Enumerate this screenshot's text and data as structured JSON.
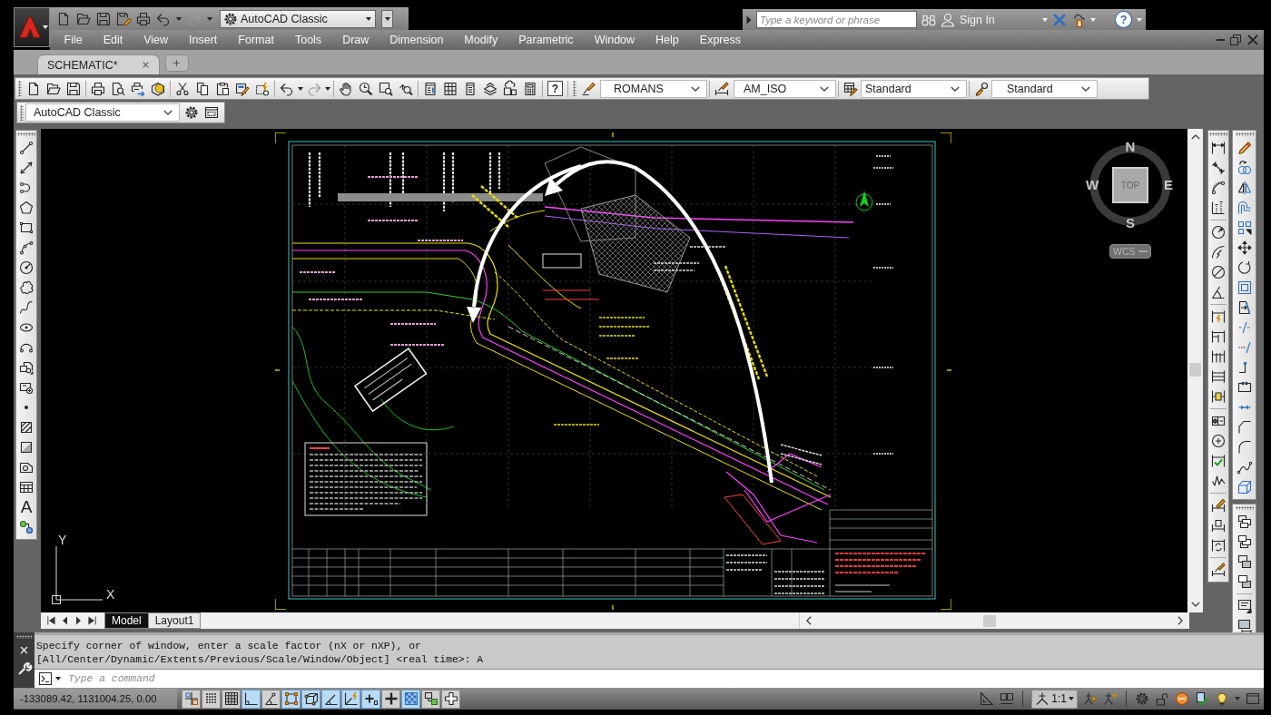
{
  "quick_access_toolbar": {
    "workspace": "AutoCAD Classic"
  },
  "infocenter": {
    "search": {
      "placeholder": "Type a keyword or phrase"
    },
    "sign_in": "Sign In",
    "help_glyph": "?"
  },
  "menu_bar": {
    "items": [
      "File",
      "Edit",
      "View",
      "Insert",
      "Format",
      "Tools",
      "Draw",
      "Dimension",
      "Modify",
      "Parametric",
      "Window",
      "Help",
      "Express"
    ]
  },
  "document_tabs": [
    {
      "label": "SCHEMATIC*",
      "selected": true
    }
  ],
  "standard_toolbar": {
    "help_glyph": "?",
    "text_style": "ROMANS",
    "dimension_style": "AM_ISO",
    "table_style": "Standard",
    "multileader_style": "Standard"
  },
  "workspaces_toolbar": {
    "workspace": "AutoCAD Classic"
  },
  "draw_toolbar": {
    "text_glyph": "A"
  },
  "viewcube": {
    "north": "N",
    "west": "W",
    "top": "TOP",
    "east": "E",
    "south": "S",
    "coordinate_system": "WCS"
  },
  "ucs_icon": {
    "y_axis": "Y",
    "x_axis": "X"
  },
  "layout_tabs": [
    {
      "label": "Model",
      "selected": true
    },
    {
      "label": "Layout1",
      "selected": false
    }
  ],
  "command_line": {
    "history": [
      "Specify corner of window, enter a scale factor (nX or nXP), or",
      "[All/Center/Dynamic/Extents/Previous/Scale/Window/Object] <real time>: A"
    ],
    "placeholder": "Type a command"
  },
  "status_bar": {
    "coordinates": "-133089.42, 1131004.25, 0.00",
    "toggles": [
      {
        "on": false
      },
      {
        "on": false
      },
      {
        "on": false
      },
      {
        "on": true
      },
      {
        "on": false
      },
      {
        "on": true
      },
      {
        "on": true
      },
      {
        "on": true
      },
      {
        "on": true
      },
      {
        "on": true
      },
      {
        "on": false
      },
      {
        "on": true
      },
      {
        "on": false
      },
      {
        "on": false
      }
    ],
    "annotation_scale": "1:1"
  }
}
